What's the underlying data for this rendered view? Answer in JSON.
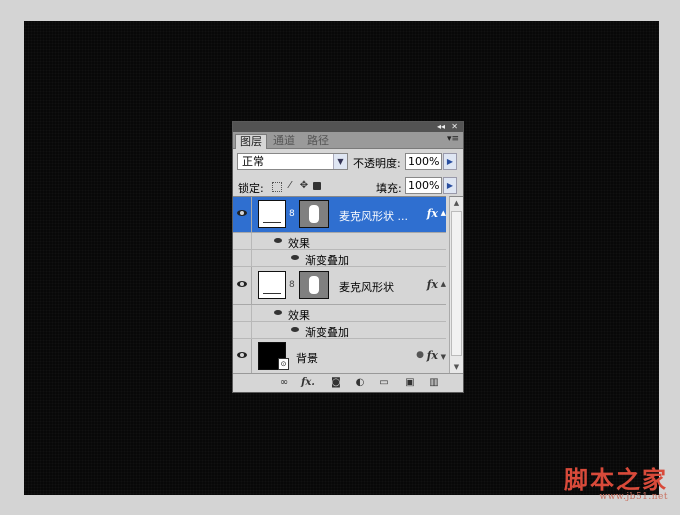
{
  "watermark": {
    "main": "脚本之家",
    "url": "www.jb51.net"
  },
  "panel": {
    "titlebar": {
      "collapse": "◂◂",
      "close": "✕"
    },
    "tabs": [
      {
        "label": "图层",
        "active": true
      },
      {
        "label": "通道",
        "active": false
      },
      {
        "label": "路径",
        "active": false
      }
    ],
    "menu_icon": "▾≡",
    "blend_mode": "正常",
    "opacity_label": "不透明度:",
    "opacity_value": "100%",
    "lock_label": "锁定:",
    "fill_label": "填充:",
    "fill_value": "100%",
    "step_arrow": "▶",
    "lock_icons": [
      "transparency-lock-icon",
      "brush-icon",
      "move-icon",
      "lock-icon"
    ],
    "layers": [
      {
        "name": "麦克风形状 ...",
        "selected": true,
        "fx": "fx",
        "thumb": "white",
        "has_mask": true
      },
      {
        "effects_label": "效果",
        "effect": "渐变叠加"
      },
      {
        "name": "麦克风形状",
        "selected": false,
        "fx": "fx",
        "thumb": "white",
        "has_mask": true
      },
      {
        "effects_label": "效果",
        "effect": "渐变叠加"
      },
      {
        "name": "背景",
        "selected": false,
        "fx": "fx",
        "thumb": "black",
        "has_mask": false
      }
    ],
    "bottom_icons": [
      "link-icon",
      "fx-icon",
      "mask-icon",
      "adjustment-icon",
      "folder-icon",
      "new-layer-icon",
      "trash-icon"
    ],
    "fx_text": "fx."
  }
}
